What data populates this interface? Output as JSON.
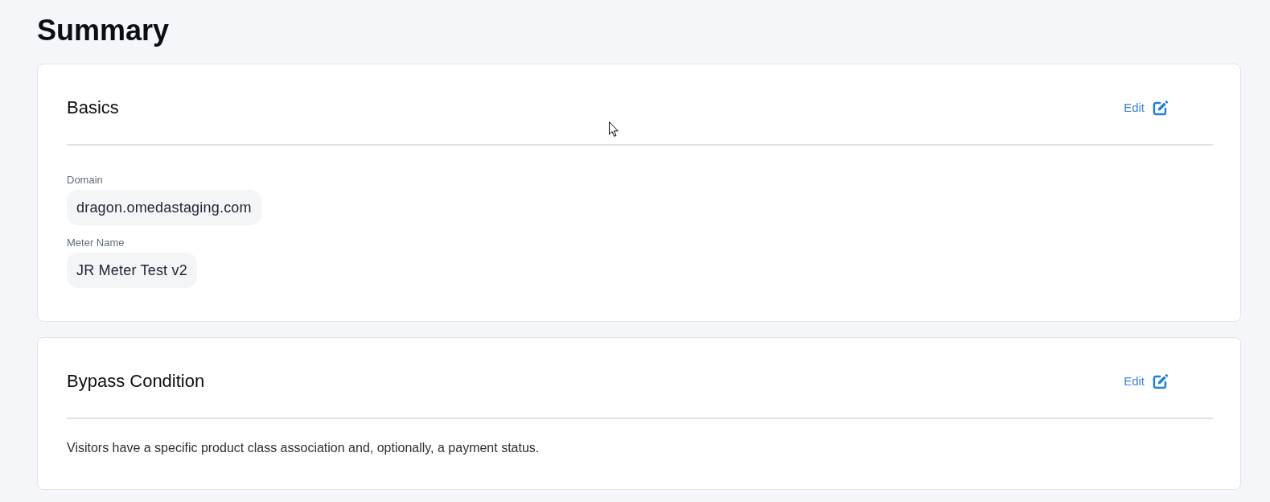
{
  "page": {
    "title": "Summary"
  },
  "sections": [
    {
      "kind": "fields",
      "title": "Basics",
      "edit_label": "Edit",
      "fields": [
        {
          "label": "Domain",
          "value": "dragon.omedastaging.com"
        },
        {
          "label": "Meter Name",
          "value": "JR Meter Test v2"
        }
      ]
    },
    {
      "kind": "text",
      "title": "Bypass Condition",
      "edit_label": "Edit",
      "text": "Visitors have a specific product class association and, optionally, a payment status."
    }
  ]
}
